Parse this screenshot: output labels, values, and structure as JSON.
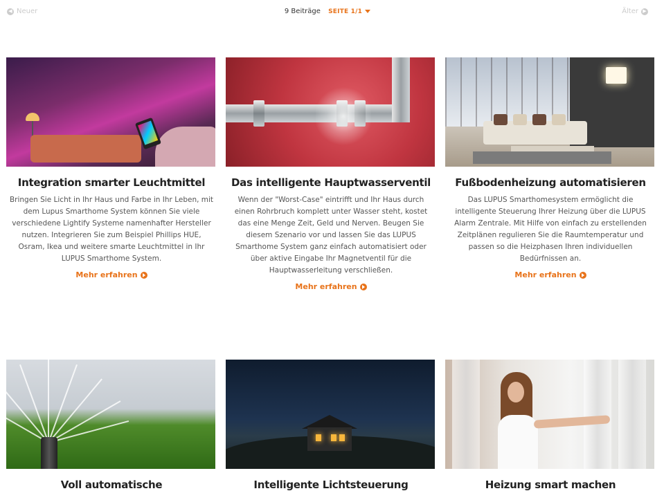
{
  "pagination": {
    "newer_label": "Neuer",
    "older_label": "Älter",
    "post_count": "9 Beiträge",
    "page_label": "SEITE 1/1"
  },
  "colors": {
    "accent": "#e8731a",
    "disabled": "#cccccc"
  },
  "posts": [
    {
      "title": "Integration smarter Leuchtmittel",
      "excerpt": "Bringen Sie Licht in Ihr Haus und Farbe in Ihr Leben, mit dem Lupus Smarthome System können Sie viele verschiedene Lightify Systeme namenhafter Hersteller nutzen. Integrieren Sie zum Beispiel Phillips HUE, Osram, Ikea und weitere smarte Leuchtmittel in Ihr LUPUS Smarthome System.",
      "more_label": "Mehr erfahren"
    },
    {
      "title": "Das intelligente Hauptwasserventil",
      "excerpt": "Wenn der \"Worst-Case\" eintrifft und Ihr Haus durch einen Rohrbruch komplett unter Wasser steht, kostet das eine Menge Zeit, Geld und Nerven. Beugen Sie diesem Szenario vor und lassen Sie das LUPUS Smarthome System ganz einfach automatisiert oder über aktive Eingabe Ihr Magnetventil für die Hauptwasserleitung verschließen.",
      "more_label": "Mehr erfahren"
    },
    {
      "title": "Fußbodenheizung automatisieren",
      "excerpt": "Das LUPUS Smarthomesystem ermöglicht die intelligente Steuerung Ihrer Heizung über die LUPUS Alarm Zentrale. Mit Hilfe von einfach zu erstellenden Zeitplänen regulieren Sie die Raumtemperatur und passen so die Heizphasen Ihren individuellen Bedürfnissen an.",
      "more_label": "Mehr erfahren"
    },
    {
      "title": "Voll automatische Gartenbewässerung"
    },
    {
      "title": "Intelligente Lichtsteuerung"
    },
    {
      "title": "Heizung smart machen"
    }
  ]
}
